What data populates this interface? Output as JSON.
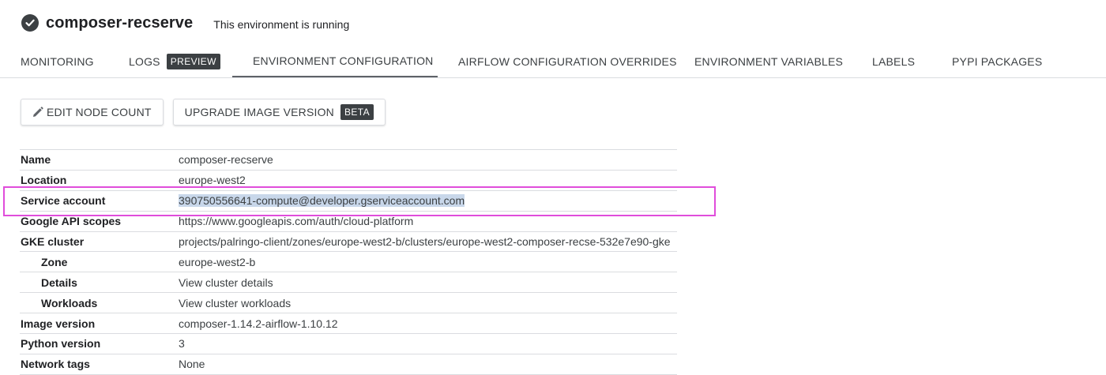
{
  "header": {
    "status_icon": "check-circle-icon",
    "env_name": "composer-recserve",
    "status_text": "This environment is running"
  },
  "tabs": [
    {
      "label": "MONITORING"
    },
    {
      "label": "LOGS",
      "badge": "PREVIEW"
    },
    {
      "label": "ENVIRONMENT CONFIGURATION",
      "active": true
    },
    {
      "label": "AIRFLOW CONFIGURATION OVERRIDES"
    },
    {
      "label": "ENVIRONMENT VARIABLES"
    },
    {
      "label": "LABELS"
    },
    {
      "label": "PYPI PACKAGES"
    }
  ],
  "actions": {
    "edit_node_count": {
      "icon": "pencil-icon",
      "label": "EDIT NODE COUNT"
    },
    "upgrade_image_version": {
      "label": "UPGRADE IMAGE VERSION",
      "badge": "BETA"
    }
  },
  "details": {
    "name": {
      "label": "Name",
      "value": "composer-recserve"
    },
    "location": {
      "label": "Location",
      "value": "europe-west2"
    },
    "service_account": {
      "label": "Service account",
      "value": "390750556641-compute@developer.gserviceaccount.com"
    },
    "api_scopes": {
      "label": "Google API scopes",
      "value": "https://www.googleapis.com/auth/cloud-platform"
    },
    "gke_cluster": {
      "label": "GKE cluster",
      "value": "projects/palringo-client/zones/europe-west2-b/clusters/europe-west2-composer-recse-532e7e90-gke"
    },
    "zone": {
      "label": "Zone",
      "value": "europe-west2-b"
    },
    "cluster_details": {
      "label": "Details",
      "value": "View cluster details"
    },
    "workloads": {
      "label": "Workloads",
      "value": "View cluster workloads"
    },
    "image_version": {
      "label": "Image version",
      "value": "composer-1.14.2-airflow-1.10.12"
    },
    "python_version": {
      "label": "Python version",
      "value": "3"
    },
    "network_tags": {
      "label": "Network tags",
      "value": "None"
    }
  },
  "colors": {
    "highlight_border": "#e04ddb",
    "selection_background": "#c8d7ea",
    "badge_background": "#3c4043"
  }
}
